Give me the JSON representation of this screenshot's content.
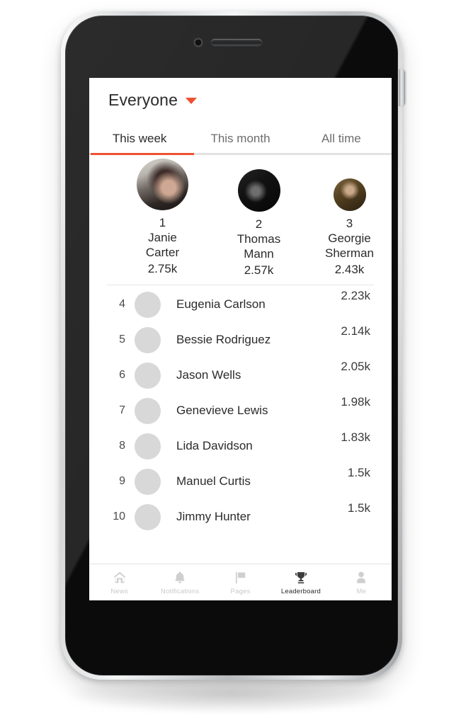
{
  "device": {
    "camera": "camera-lens",
    "speaker": "earpiece-speaker",
    "side_button": "volume-button"
  },
  "header": {
    "scope_label": "Everyone",
    "caret_icon": "chevron-down-icon",
    "caret_color": "#ef5130"
  },
  "tabs": {
    "accent_color": "#ee5231",
    "items": [
      {
        "label": "This week",
        "active": true
      },
      {
        "label": "This month",
        "active": false
      },
      {
        "label": "All time",
        "active": false
      }
    ]
  },
  "podium": [
    {
      "rank": "1",
      "first": "Janie",
      "last": "Carter",
      "score": "2.75k",
      "photo": "ph-janie"
    },
    {
      "rank": "2",
      "first": "Thomas",
      "last": "Mann",
      "score": "2.57k",
      "photo": "ph-thomas"
    },
    {
      "rank": "3",
      "first": "Georgie",
      "last": "Sherman",
      "score": "2.43k",
      "photo": "ph-georgie"
    }
  ],
  "list": [
    {
      "rank": "4",
      "name": "Eugenia Carlson",
      "score": "2.23k",
      "photo": "ph-eugenia"
    },
    {
      "rank": "5",
      "name": "Bessie Rodriguez",
      "score": "2.14k",
      "photo": "ph-bessie"
    },
    {
      "rank": "6",
      "name": "Jason Wells",
      "score": "2.05k",
      "photo": "ph-jason"
    },
    {
      "rank": "7",
      "name": "Genevieve Lewis",
      "score": "1.98k",
      "photo": "ph-genevieve"
    },
    {
      "rank": "8",
      "name": "Lida Davidson",
      "score": "1.83k",
      "photo": "ph-lida"
    },
    {
      "rank": "9",
      "name": "Manuel Curtis",
      "score": "1.5k",
      "photo": "ph-manuel"
    },
    {
      "rank": "10",
      "name": "Jimmy Hunter",
      "score": "1.5k",
      "photo": "ph-jimmy"
    }
  ],
  "navbar": {
    "items": [
      {
        "label": "News",
        "icon": "home-icon",
        "active": false
      },
      {
        "label": "Notifications",
        "icon": "bell-icon",
        "active": false
      },
      {
        "label": "Pages",
        "icon": "flag-icon",
        "active": false
      },
      {
        "label": "Leaderboard",
        "icon": "trophy-icon",
        "active": true
      },
      {
        "label": "Me",
        "icon": "person-icon",
        "active": false
      }
    ]
  }
}
